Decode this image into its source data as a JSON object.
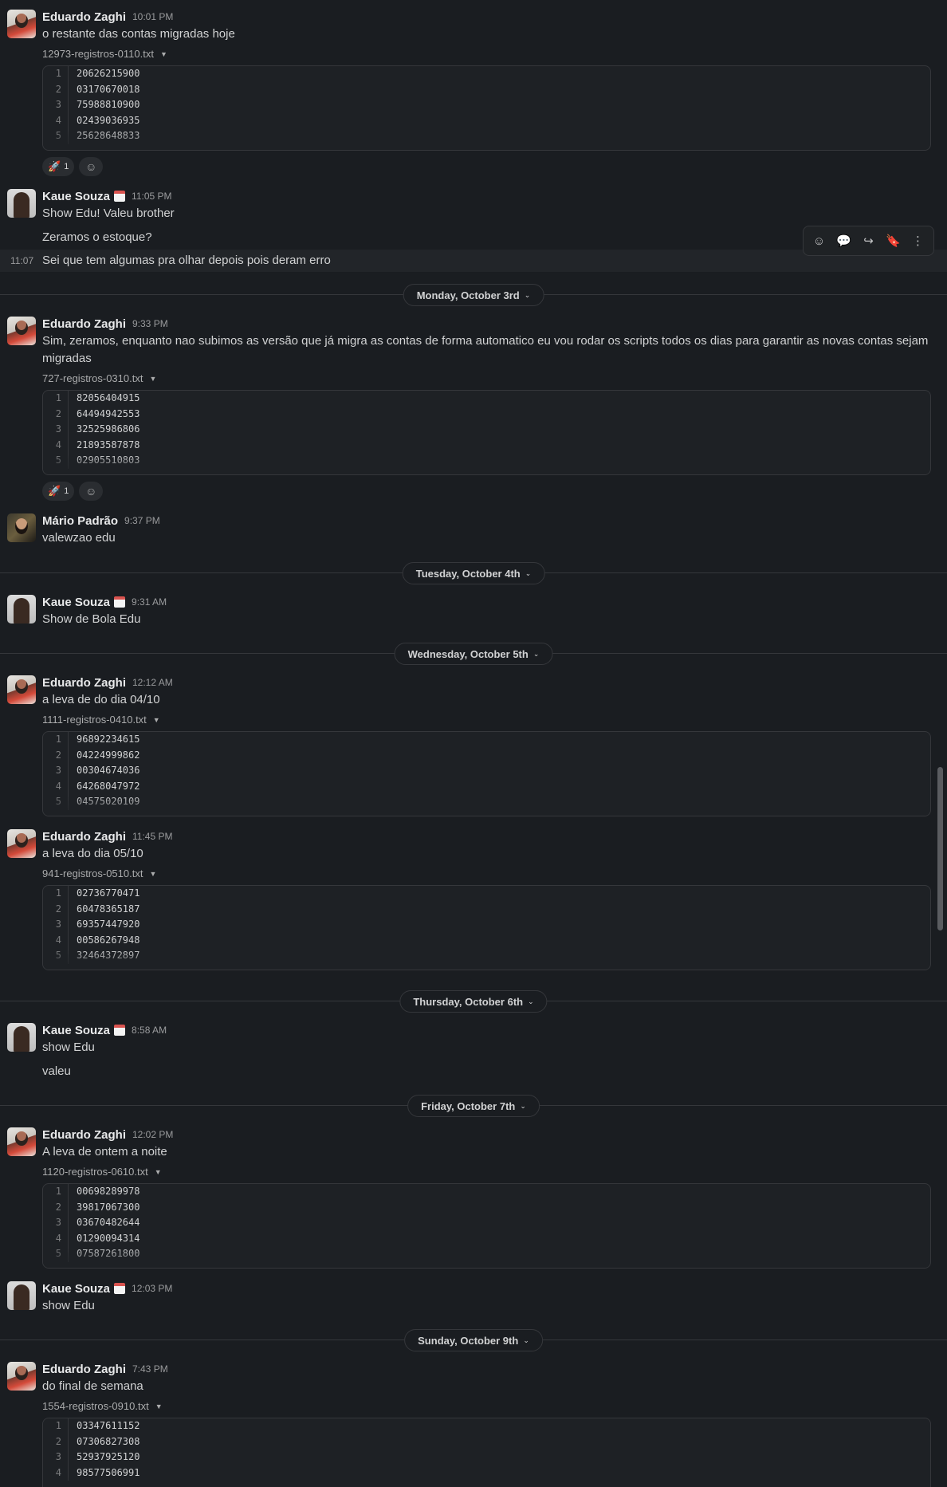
{
  "messages": [
    {
      "author": "Eduardo Zaghi",
      "time": "10:01 PM",
      "text": "o restante das contas migradas hoje",
      "file": "12973-registros-0110.txt",
      "lines": [
        "20626215900",
        "03170670018",
        "75988810900",
        "02439036935",
        "25628648833"
      ],
      "reaction": {
        "emoji": "🚀",
        "count": "1"
      }
    },
    {
      "author": "Kaue Souza",
      "time": "11:05 PM",
      "text": "Show Edu! Valeu brother",
      "text2": "Zeramos o estoque?",
      "hover_time": "11:07",
      "hover_text": "Sei que tem algumas pra olhar depois pois deram erro"
    },
    {
      "date": "Monday, October 3rd",
      "author": "Eduardo Zaghi",
      "time": "9:33 PM",
      "text": "Sim, zeramos, enquanto nao subimos as versão que já migra as contas de forma automatico eu vou rodar os scripts todos os dias para garantir as  novas contas sejam migradas",
      "file": "727-registros-0310.txt",
      "lines": [
        "82056404915",
        "64494942553",
        "32525986806",
        "21893587878",
        "02905510803"
      ],
      "reaction": {
        "emoji": "🚀",
        "count": "1"
      }
    },
    {
      "author": "Mário Padrão",
      "time": "9:37 PM",
      "text": "valewzao edu"
    },
    {
      "date": "Tuesday, October 4th",
      "author": "Kaue Souza",
      "time": "9:31 AM",
      "text": "Show de Bola Edu"
    },
    {
      "date": "Wednesday, October 5th",
      "author": "Eduardo Zaghi",
      "time": "12:12 AM",
      "text": "a leva de do dia 04/10",
      "file": "1111-registros-0410.txt",
      "lines": [
        "96892234615",
        "04224999862",
        "00304674036",
        "64268047972",
        "04575020109"
      ]
    },
    {
      "author": "Eduardo Zaghi",
      "time": "11:45 PM",
      "text": "a leva do dia 05/10",
      "file": "941-registros-0510.txt",
      "lines": [
        "02736770471",
        "60478365187",
        "69357447920",
        "00586267948",
        "32464372897"
      ]
    },
    {
      "date": "Thursday, October 6th",
      "author": "Kaue Souza",
      "time": "8:58 AM",
      "text": "show Edu",
      "text2": "valeu"
    },
    {
      "date": "Friday, October 7th",
      "author": "Eduardo Zaghi",
      "time": "12:02 PM",
      "text": "A leva de ontem a noite",
      "file": "1120-registros-0610.txt",
      "lines": [
        "00698289978",
        "39817067300",
        "03670482644",
        "01290094314",
        "07587261800"
      ]
    },
    {
      "author": "Kaue Souza",
      "time": "12:03 PM",
      "text": "show Edu"
    },
    {
      "date": "Sunday, October 9th",
      "author": "Eduardo Zaghi",
      "time": "7:43 PM",
      "text": "do final de semana",
      "file": "1554-registros-0910.txt",
      "lines": [
        "03347611152",
        "07306827308",
        "52937925120",
        "98577506991"
      ]
    }
  ],
  "line_numbers": [
    "1",
    "2",
    "3",
    "4",
    "5"
  ],
  "toolbar_icons": [
    "add-reaction-icon",
    "reply-in-thread-icon",
    "share-message-icon",
    "bookmark-icon",
    "more-actions-icon"
  ],
  "colors": {
    "background": "#1a1d21",
    "text": "#d1d2d3",
    "muted": "#9a9b9d",
    "border": "#35373b"
  }
}
